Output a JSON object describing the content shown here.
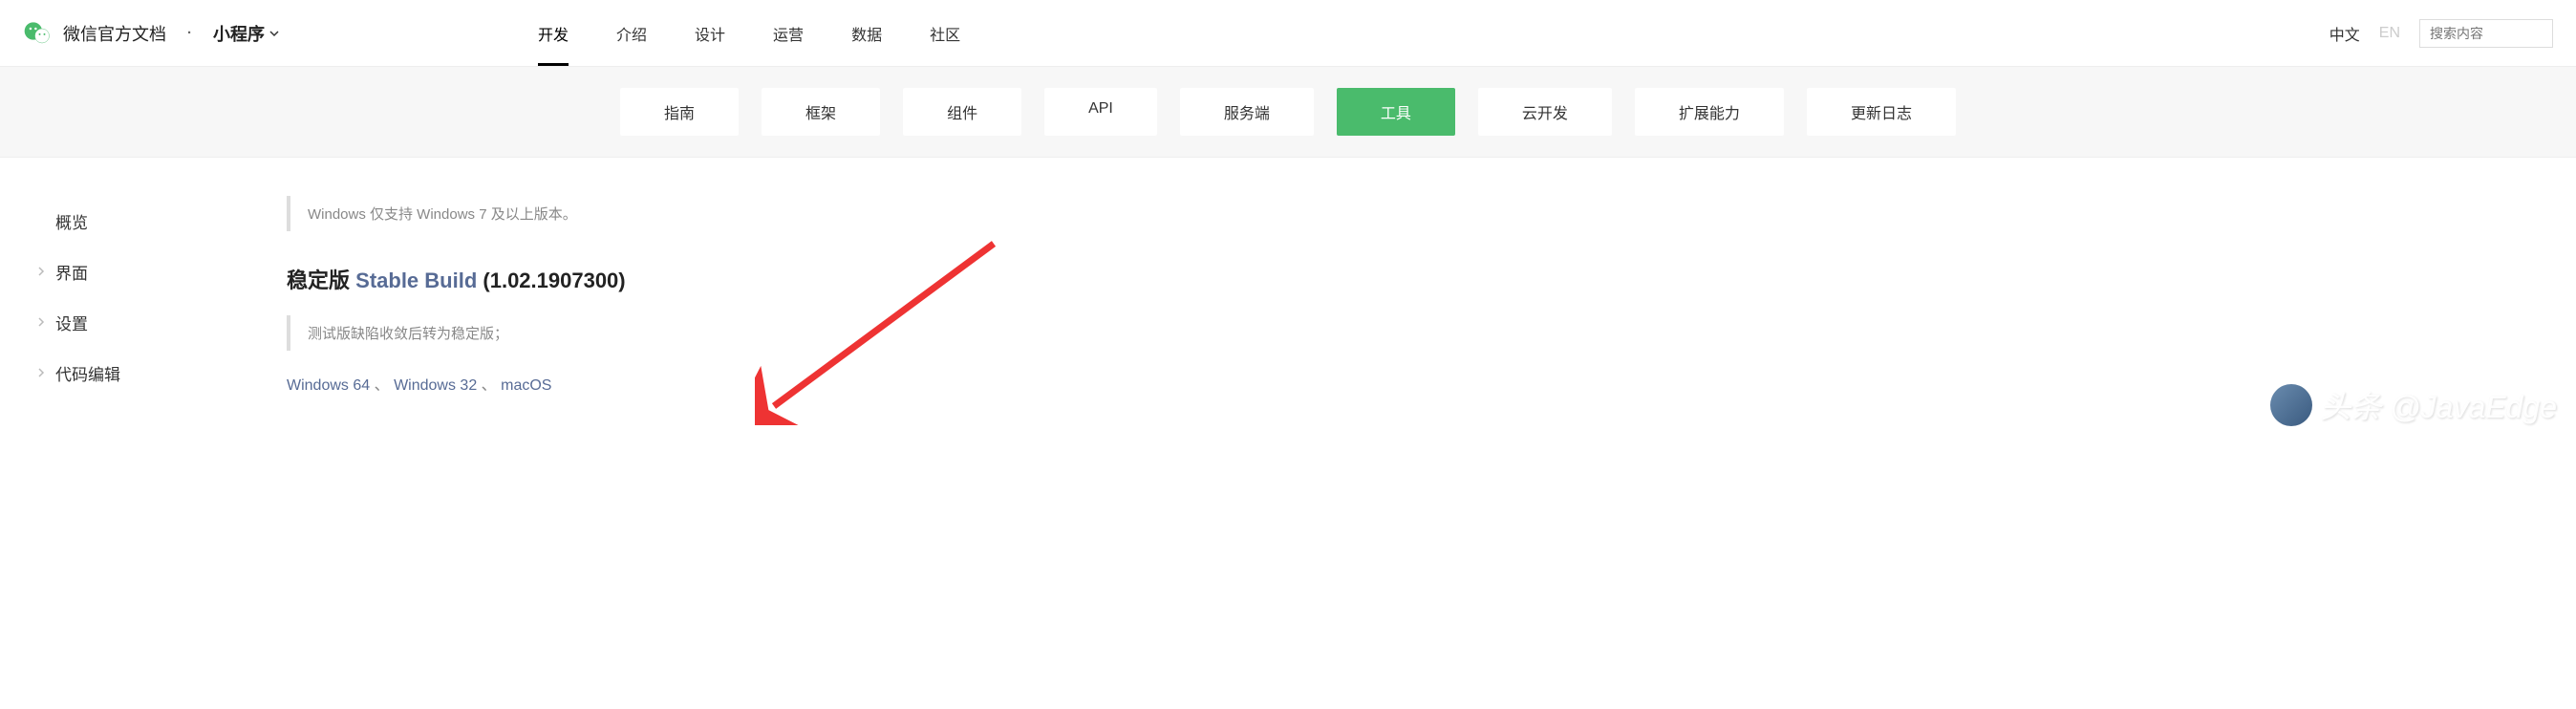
{
  "header": {
    "brand": "微信官方文档",
    "dropdown_label": "小程序",
    "nav": [
      {
        "label": "开发",
        "active": true
      },
      {
        "label": "介绍",
        "active": false
      },
      {
        "label": "设计",
        "active": false
      },
      {
        "label": "运营",
        "active": false
      },
      {
        "label": "数据",
        "active": false
      },
      {
        "label": "社区",
        "active": false
      }
    ],
    "lang_active": "中文",
    "lang_inactive": "EN",
    "search_placeholder": "搜索内容"
  },
  "sub_nav": [
    {
      "label": "指南",
      "active": false
    },
    {
      "label": "框架",
      "active": false
    },
    {
      "label": "组件",
      "active": false
    },
    {
      "label": "API",
      "active": false
    },
    {
      "label": "服务端",
      "active": false
    },
    {
      "label": "工具",
      "active": true
    },
    {
      "label": "云开发",
      "active": false
    },
    {
      "label": "扩展能力",
      "active": false
    },
    {
      "label": "更新日志",
      "active": false
    }
  ],
  "sidebar": [
    {
      "label": "概览",
      "expandable": false
    },
    {
      "label": "界面",
      "expandable": true
    },
    {
      "label": "设置",
      "expandable": true
    },
    {
      "label": "代码编辑",
      "expandable": true
    }
  ],
  "content": {
    "notice": "Windows 仅支持 Windows 7 及以上版本。",
    "version_label_cn": "稳定版",
    "version_label_en": "Stable Build",
    "version_number": "(1.02.1907300)",
    "sub_notice": "测试版缺陷收敛后转为稳定版；",
    "downloads": [
      "Windows 64",
      "Windows 32",
      "macOS"
    ],
    "download_sep": " 、 "
  },
  "watermark": "头条 @JavaEdge"
}
